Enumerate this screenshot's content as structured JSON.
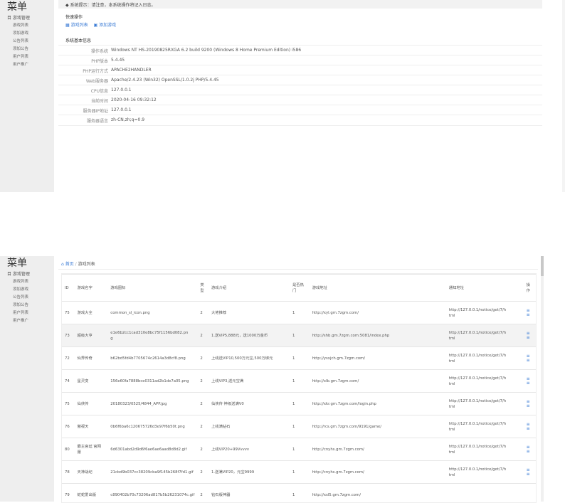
{
  "top": {
    "menu_title": "菜单",
    "notice": "◆ 系统提示：请注意，本系统操作将记入日志。",
    "sidebar_group": "目 游戏管理",
    "sidebar_items": [
      "游戏列表",
      "添加游戏",
      "公告列表",
      "添加公告",
      "用户列表",
      "用户推广"
    ],
    "quick_ops_title": "快速操作",
    "quick_links": [
      "游戏列表",
      "添加游戏"
    ],
    "sysinfo_title": "系统基本信息",
    "sysinfo": [
      {
        "label": "操作系统",
        "value": "Windows NT HS-20190825RXGA 6.2 build 9200 (Windows 8 Home Premium Edition) i586"
      },
      {
        "label": "PHP版本",
        "value": "5.4.45"
      },
      {
        "label": "PHP运行方式",
        "value": "APACHE2HANDLER"
      },
      {
        "label": "Web服务器",
        "value": "Apache/2.4.23 (Win32) OpenSSL/1.0.2j PHP/5.4.45"
      },
      {
        "label": "CPU信息",
        "value": "127.0.0.1"
      },
      {
        "label": "当前时间",
        "value": "2020-04-16 09:32:12"
      },
      {
        "label": "服务器IP地址",
        "value": "127.0.0.1"
      },
      {
        "label": "服务器语言",
        "value": "zh-CN,zh;q=0.9"
      }
    ]
  },
  "bottom": {
    "menu_title": "菜单",
    "breadcrumb_home": "首页",
    "breadcrumb_current": "游戏列表",
    "sidebar_group": "目 游戏管理",
    "sidebar_items": [
      "游戏列表",
      "添加游戏",
      "公告列表",
      "添加公告",
      "用户列表",
      "用户推广"
    ],
    "columns": {
      "id": "ID",
      "name": "游戏名字",
      "icon": "游戏图标",
      "type": [
        "类",
        "型"
      ],
      "intro": "游戏介绍",
      "rec": [
        "是否热",
        "门"
      ],
      "url": "游戏地址",
      "notice": "通知地址",
      "op": [
        "操",
        "作"
      ]
    },
    "rows": [
      {
        "id": "75",
        "name": "游戏大全",
        "icon": [
          "common_sl_icon.png"
        ],
        "type": "2",
        "intro": "大佬推荐",
        "rec": "1",
        "url": "http://xyl.gm.7zgm.com/",
        "notice": [
          "http://127.0.0.1/notice/get/7/h",
          "tml"
        ]
      },
      {
        "id": "73",
        "name": "超级大亨",
        "icon": [
          "e1e6b2cc1cad310e8bc75f1156bd082.pn",
          "g"
        ],
        "type": "2",
        "intro": "1.送VIP5,888元，送1000万金币",
        "rec": "1",
        "url": "http://shb.gm.7zgm.com:5081/index.php",
        "notice": [
          "http://127.0.0.1/notice/get/7/h",
          "tml"
        ]
      },
      {
        "id": "72",
        "name": "仙界传奇",
        "icon": [
          "b62bd5fd4b7705674c2614a3d8cf8.png"
        ],
        "type": "2",
        "intro": "上线送VIP10,500万元宝,500万绑元",
        "rec": "1",
        "url": "http://ysxjch.gm.7zgm.com/",
        "notice": [
          "http://127.0.0.1/notice/get/7/h",
          "tml"
        ]
      },
      {
        "id": "74",
        "name": "星灵变",
        "icon": [
          "156e60fa7888bce0311ad2b1de7a05.png"
        ],
        "type": "2",
        "intro": "上线VIP3,送元宝满",
        "rec": "1",
        "url": "http://xlb.gm.7zgm.com/",
        "notice": [
          "http://127.0.0.1/notice/get/7/h",
          "tml"
        ]
      },
      {
        "id": "75",
        "name": "仙侠传",
        "icon": [
          "20180323/0525/4844_APP.jpg"
        ],
        "type": "2",
        "intro": "仙侠传 神级送满V0",
        "rec": "1",
        "url": "http://xkr.gm.7zgm.com/login.php",
        "notice": [
          "http://127.0.0.1/notice/get/7/h",
          "tml"
        ]
      },
      {
        "id": "76",
        "name": "傲视天",
        "icon": [
          "0b6f6ba6c120675726d3e97f6b50t.png"
        ],
        "type": "2",
        "intro": "上线满钻石",
        "rec": "1",
        "url": "http://rcs.gm.7zgm.com/9191/game/",
        "notice": [
          "http://127.0.0.1/notice/get/7/h",
          "tml"
        ]
      },
      {
        "id": "80",
        "name": "霸主宫廷 官网服",
        "icon": [
          "6d6301abd2d9d6f6ae6ae6aad8d8d2.gif"
        ],
        "type": "2",
        "intro": "上线VIP20+99Vvvvv",
        "rec": "1",
        "url": "http://cnyhs.gm.7zgm.com/",
        "notice": [
          "http://127.0.0.1/notice/get/7/h",
          "tml"
        ]
      },
      {
        "id": "78",
        "name": "天神战纪",
        "icon": [
          "21cbd9b037cc38209cba9f145b268f7fd1.gif"
        ],
        "type": "2",
        "intro": "1.送满VIP20，元宝9999",
        "rec": "1",
        "url": "http://cnyhs.gm.7zgm.com/",
        "notice": [
          "http://127.0.0.1/notice/get/7/h",
          "tml"
        ]
      },
      {
        "id": "79",
        "name": "蛇蛇爱出版",
        "icon": [
          "c890402b70c73206ad817b5b26231074c.gif"
        ],
        "type": "2",
        "intro": "钻石版神器",
        "rec": "1",
        "url": "http://xsl5.gm.7zgm.com/",
        "notice": []
      }
    ]
  }
}
